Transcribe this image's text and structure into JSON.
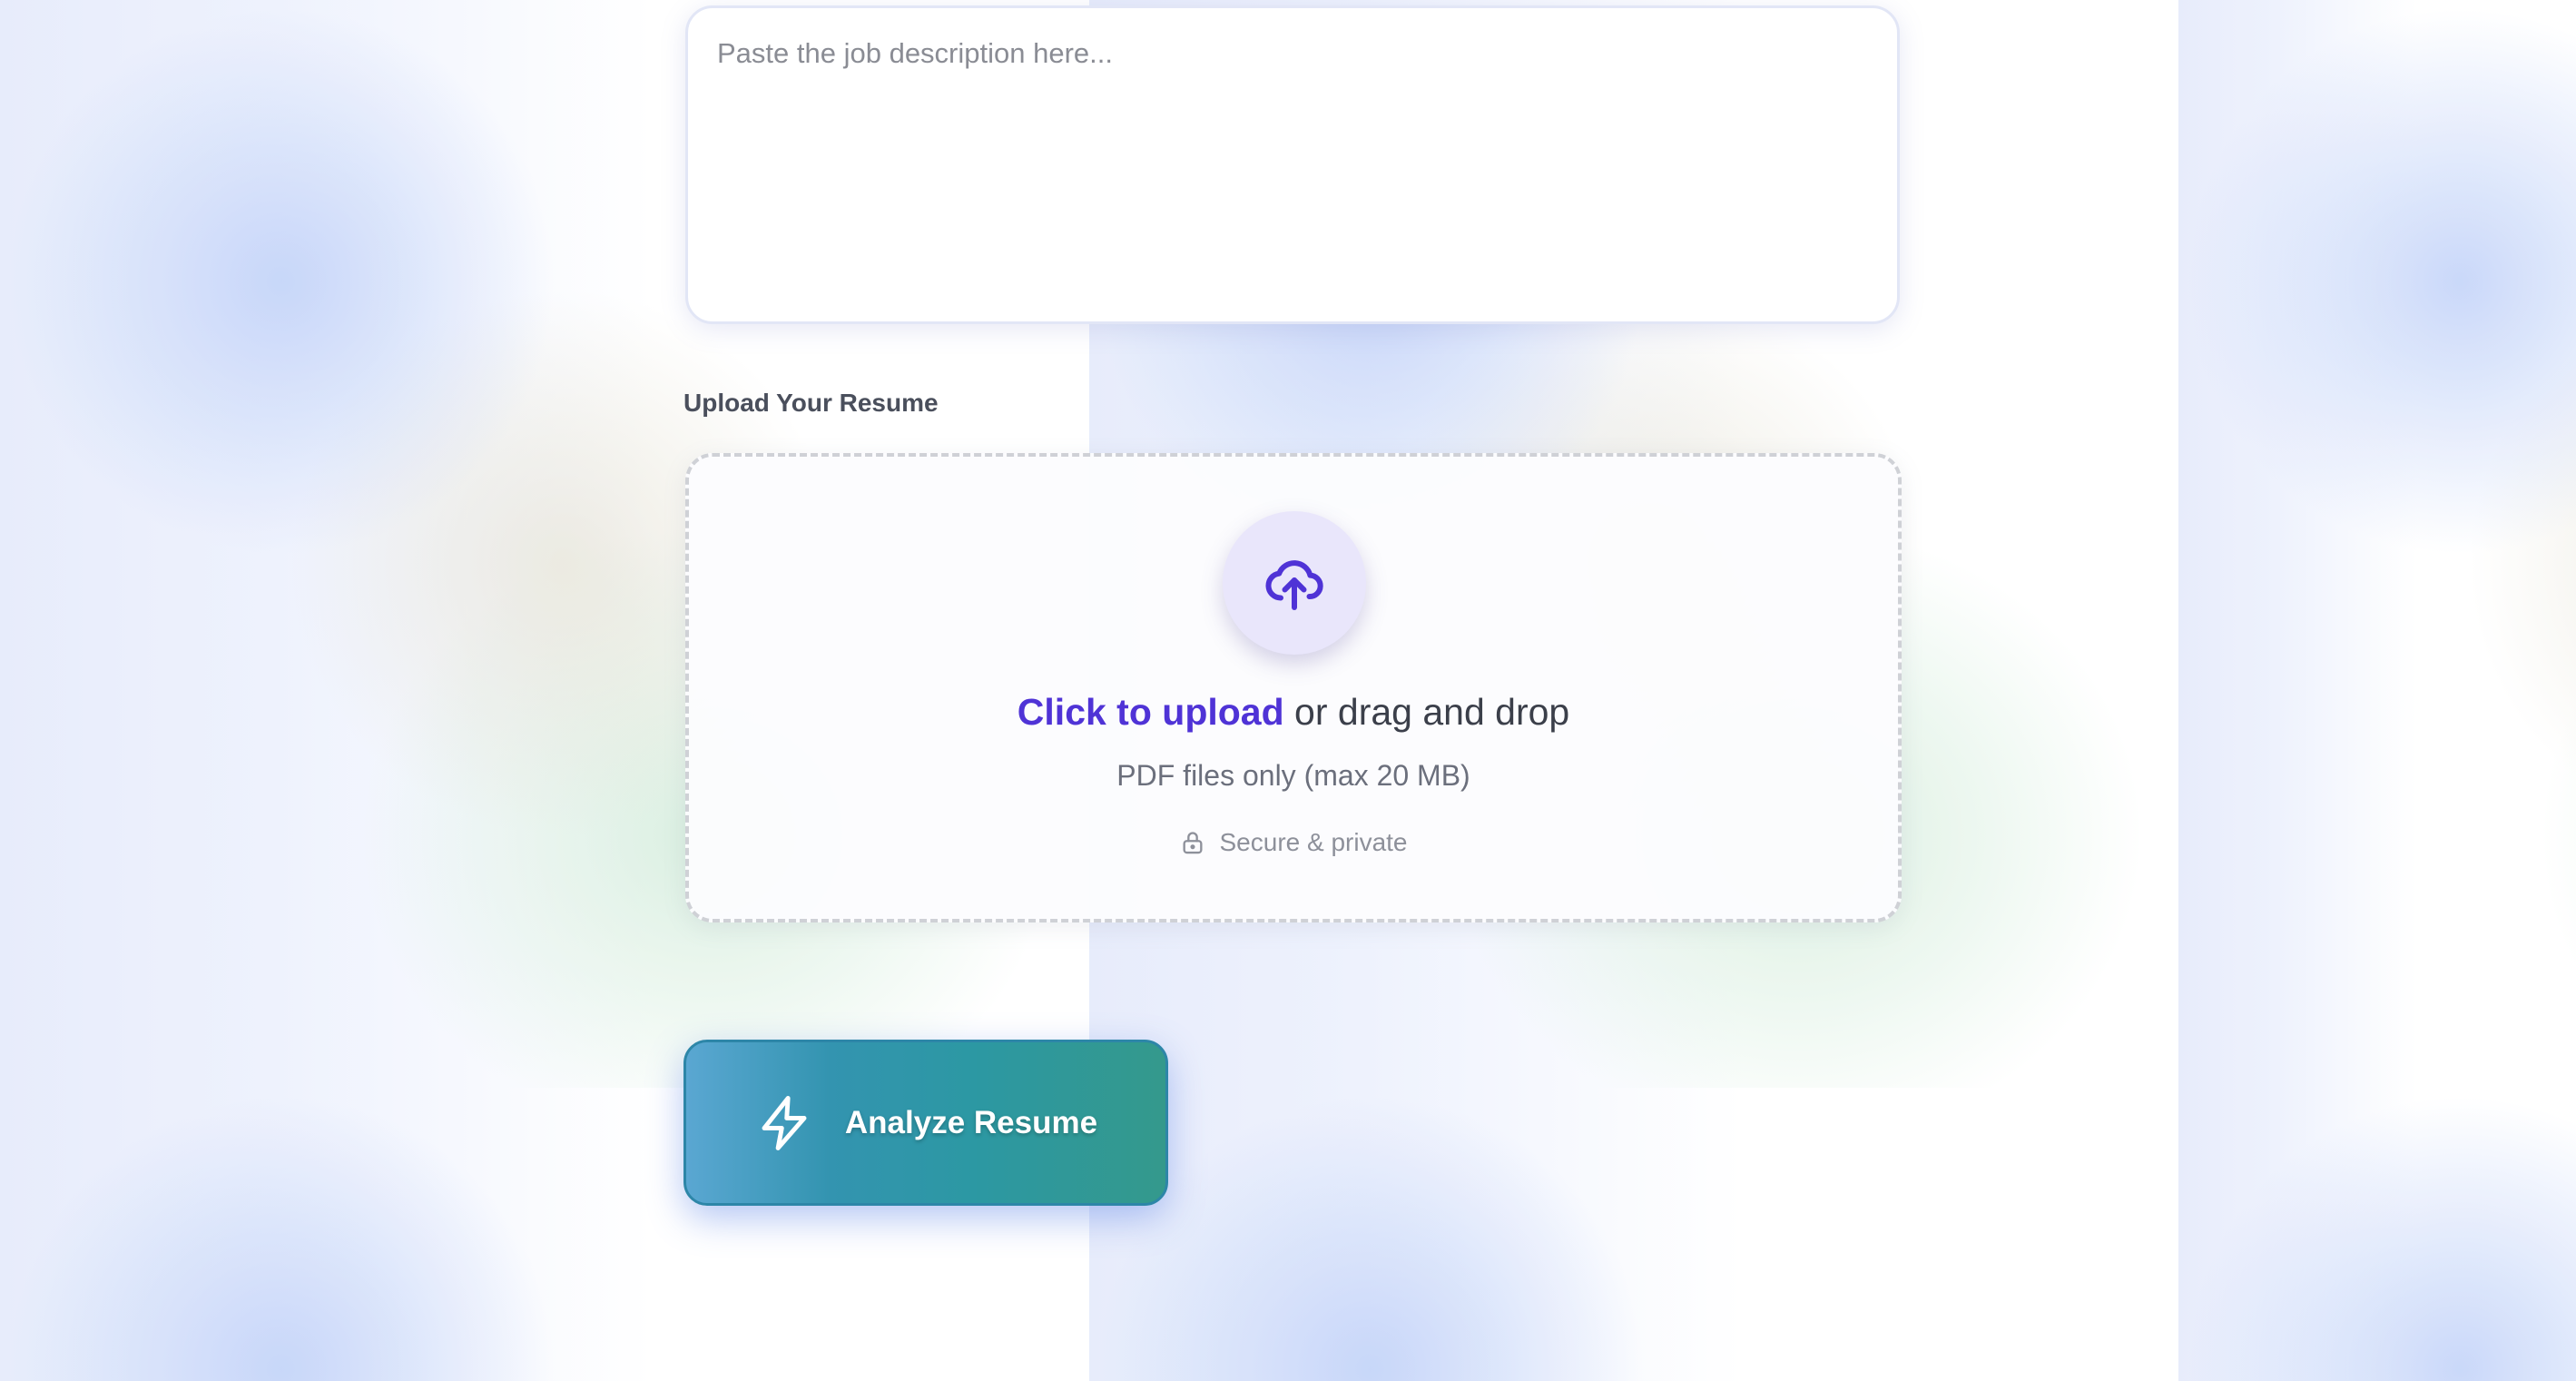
{
  "job_description": {
    "placeholder": "Paste the job description here...",
    "value": ""
  },
  "upload": {
    "section_label": "Upload Your Resume",
    "icon": "cloud-upload-icon",
    "click_text": "Click to upload",
    "rest_text": " or drag and drop",
    "sub_text": "PDF files only (max 20 MB)",
    "secure_icon": "lock-icon",
    "secure_text": "Secure & private"
  },
  "analyze_button": {
    "icon": "lightning-bolt-icon",
    "label": "Analyze Resume"
  },
  "colors": {
    "accent": "#4f33d6",
    "button_start": "#5aa7d2",
    "button_end": "#34998c"
  }
}
